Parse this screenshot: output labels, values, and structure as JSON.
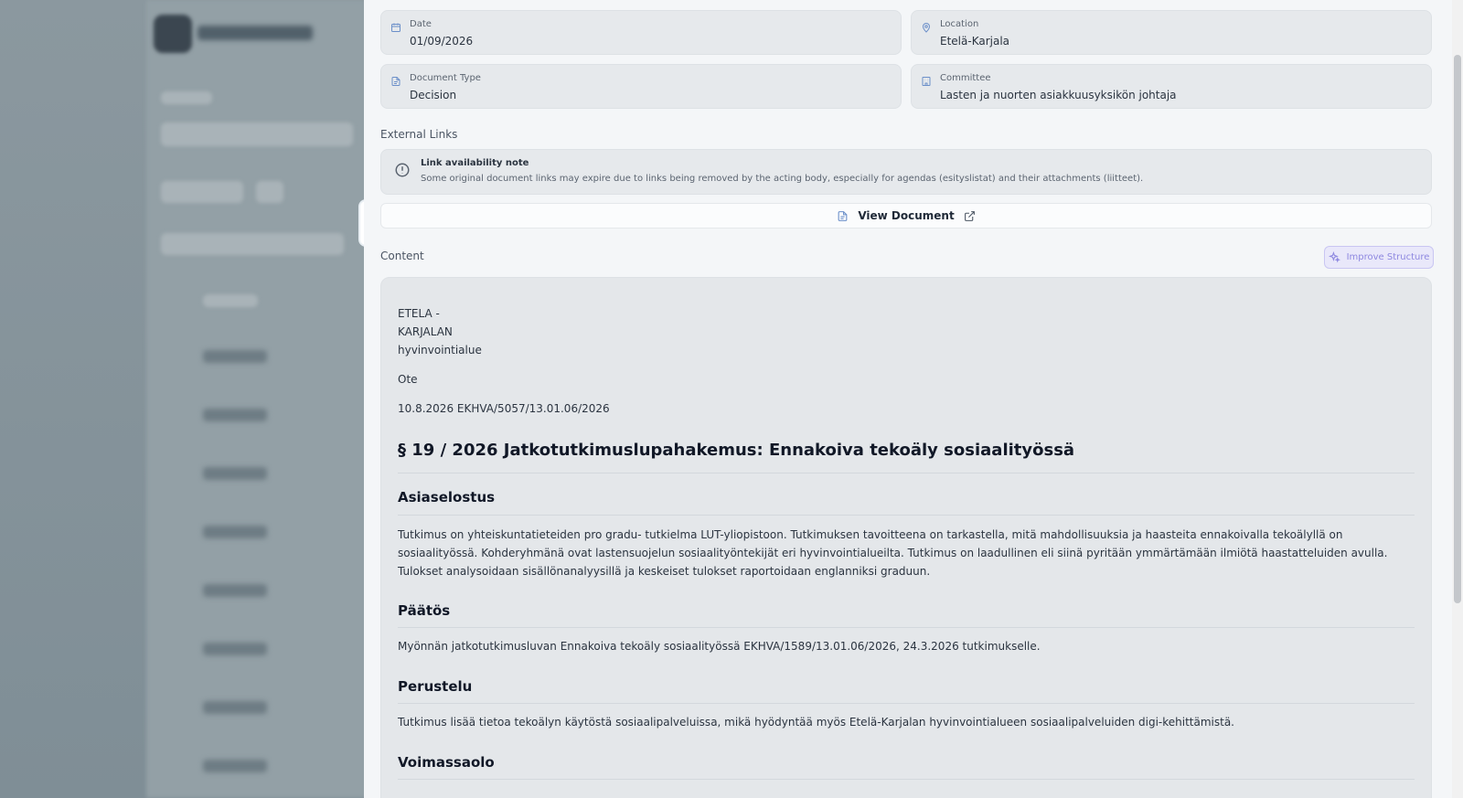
{
  "fields": {
    "date": {
      "label": "Date",
      "value": "01/09/2026"
    },
    "location": {
      "label": "Location",
      "value": "Etelä-Karjala"
    },
    "document_type": {
      "label": "Document Type",
      "value": "Decision"
    },
    "committee": {
      "label": "Committee",
      "value": "Lasten ja nuorten asiakkuusyksikön johtaja"
    }
  },
  "external_links": {
    "title": "External Links",
    "note_title": "Link availability note",
    "note_text": "Some original document links may expire due to links being removed by the acting body, especially for agendas (esityslistat) and their attachments (liitteet).",
    "view_document": "View Document"
  },
  "content": {
    "title": "Content",
    "improve_button": "Improve Structure",
    "header_lines": [
      "ETELA -",
      "KARJALAN",
      "hyvinvointialue"
    ],
    "ote": "Ote",
    "reference": "10.8.2026 EKHVA/5057/13.01.06/2026",
    "heading": "§ 19 / 2026 Jatkotutkimuslupahakemus: Ennakoiva tekoäly sosiaalityössä",
    "sections": [
      {
        "title": "Asiaselostus",
        "text": "Tutkimus on yhteiskuntatieteiden pro gradu- tutkielma LUT-yliopistoon. Tutkimuksen tavoitteena on tarkastella, mitä mahdollisuuksia ja haasteita ennakoivalla tekoälyllä on sosiaalityössä. Kohderyhmänä ovat lastensuojelun sosiaalityöntekijät eri hyvinvointialueilta. Tutkimus on laadullinen eli siinä pyritään ymmärtämään ilmiötä haastatteluiden avulla. Tulokset analysoidaan sisällönanalyysillä ja keskeiset tulokset raportoidaan englanniksi graduun."
      },
      {
        "title": "Päätös",
        "text": "Myönnän jatkotutkimusluvan Ennakoiva tekoäly sosiaalityössä EKHVA/1589/13.01.06/2026, 24.3.2026 tutkimukselle."
      },
      {
        "title": "Perustelu",
        "text": "Tutkimus lisää tietoa tekoälyn käytöstä sosiaalipalveluissa, mikä hyödyntää myös Etelä-Karjalan hyvinvointialueen sosiaalipalveluiden digi-kehittämistä."
      },
      {
        "title": "Voimassaolo",
        "text": ""
      }
    ]
  }
}
